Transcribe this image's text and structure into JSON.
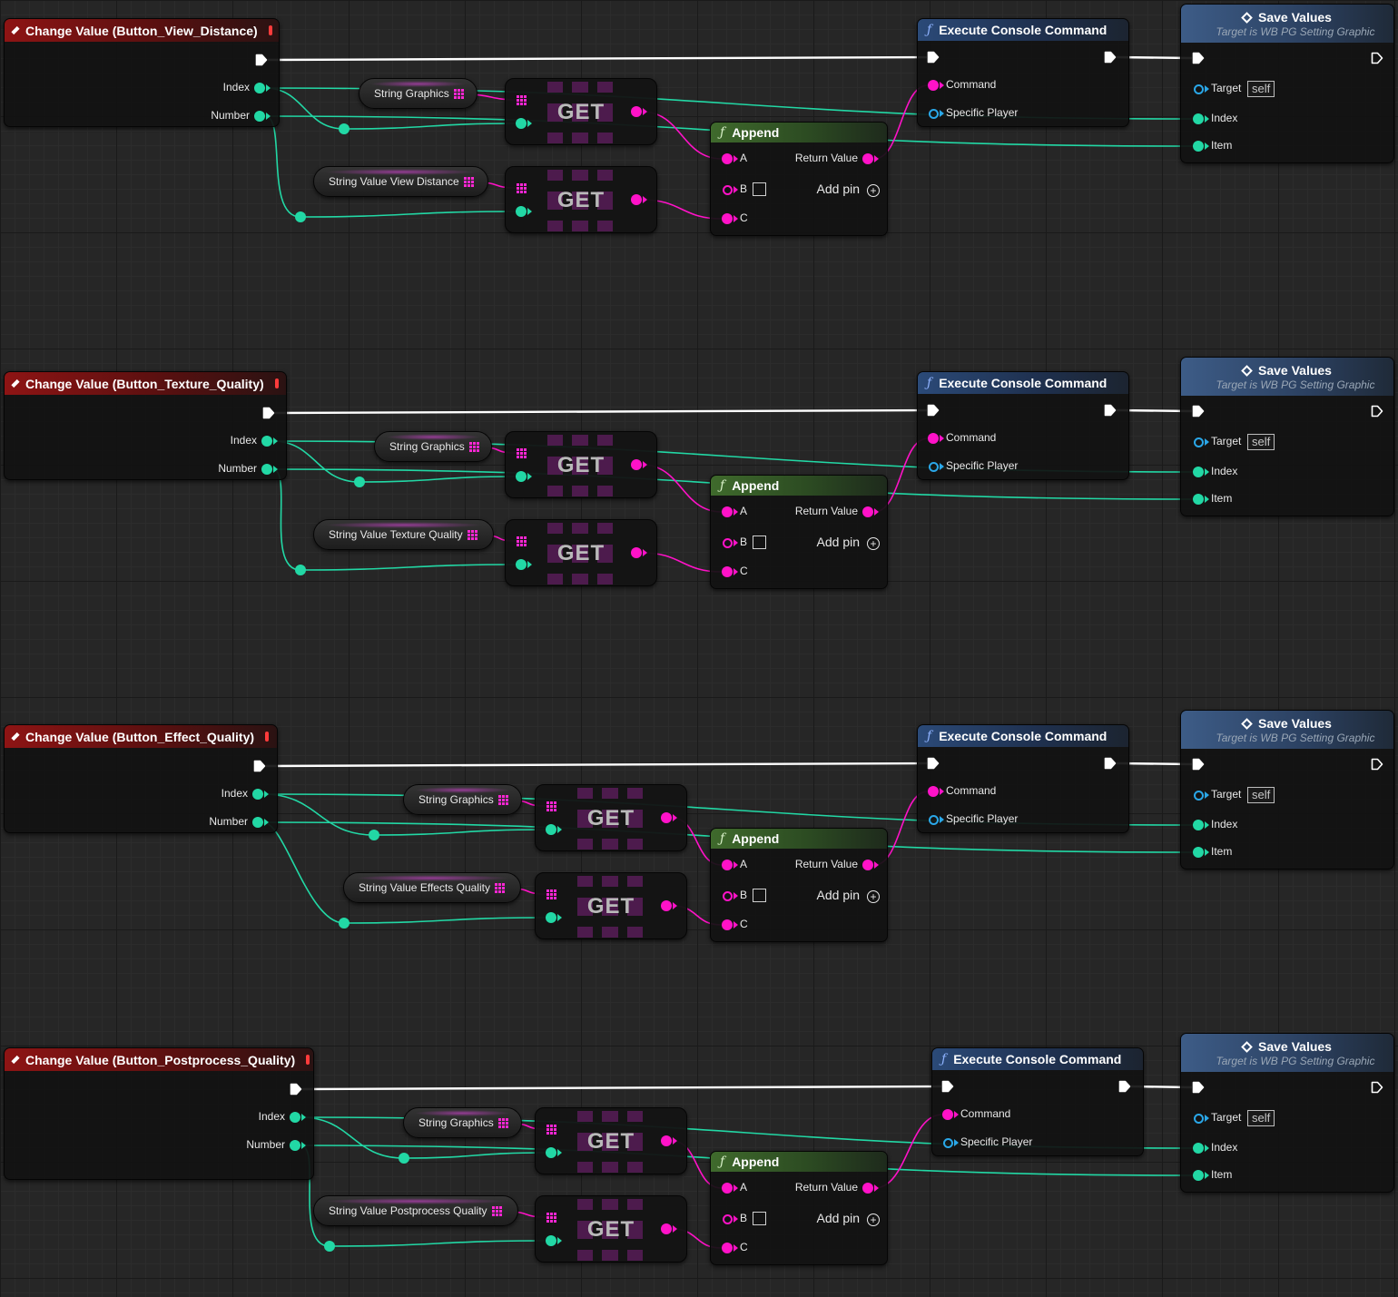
{
  "graphs": [
    {
      "event_title": "Change Value (Button_View_Distance)",
      "event_pins": {
        "index": "Index",
        "number": "Number"
      },
      "var_graphics": "String Graphics",
      "var_value": "String Value View Distance",
      "get_label": "GET",
      "append": {
        "title": "Append",
        "a": "A",
        "b": "B",
        "c": "C",
        "return": "Return Value",
        "add_pin": "Add pin"
      },
      "exec_cmd": {
        "title": "Execute Console Command",
        "command": "Command",
        "player": "Specific Player"
      },
      "save": {
        "title": "Save Values",
        "subtitle": "Target is WB PG Setting Graphic",
        "target": "Target",
        "self": "self",
        "index": "Index",
        "item": "Item"
      }
    },
    {
      "event_title": "Change Value (Button_Texture_Quality)",
      "event_pins": {
        "index": "Index",
        "number": "Number"
      },
      "var_graphics": "String Graphics",
      "var_value": "String Value Texture Quality",
      "get_label": "GET",
      "append": {
        "title": "Append",
        "a": "A",
        "b": "B",
        "c": "C",
        "return": "Return Value",
        "add_pin": "Add pin"
      },
      "exec_cmd": {
        "title": "Execute Console Command",
        "command": "Command",
        "player": "Specific Player"
      },
      "save": {
        "title": "Save Values",
        "subtitle": "Target is WB PG Setting Graphic",
        "target": "Target",
        "self": "self",
        "index": "Index",
        "item": "Item"
      }
    },
    {
      "event_title": "Change Value (Button_Effect_Quality)",
      "event_pins": {
        "index": "Index",
        "number": "Number"
      },
      "var_graphics": "String Graphics",
      "var_value": "String Value Effects Quality",
      "get_label": "GET",
      "append": {
        "title": "Append",
        "a": "A",
        "b": "B",
        "c": "C",
        "return": "Return Value",
        "add_pin": "Add pin"
      },
      "exec_cmd": {
        "title": "Execute Console Command",
        "command": "Command",
        "player": "Specific Player"
      },
      "save": {
        "title": "Save Values",
        "subtitle": "Target is WB PG Setting Graphic",
        "target": "Target",
        "self": "self",
        "index": "Index",
        "item": "Item"
      }
    },
    {
      "event_title": "Change Value (Button_Postprocess_Quality)",
      "event_pins": {
        "index": "Index",
        "number": "Number"
      },
      "var_graphics": "String Graphics",
      "var_value": "String Value Postprocess Quality",
      "get_label": "GET",
      "append": {
        "title": "Append",
        "a": "A",
        "b": "B",
        "c": "C",
        "return": "Return Value",
        "add_pin": "Add pin"
      },
      "exec_cmd": {
        "title": "Execute Console Command",
        "command": "Command",
        "player": "Specific Player"
      },
      "save": {
        "title": "Save Values",
        "subtitle": "Target is WB PG Setting Graphic",
        "target": "Target",
        "self": "self",
        "index": "Index",
        "item": "Item"
      }
    }
  ],
  "colors": {
    "background": "#262626",
    "integer_pin": "#22d8a5",
    "string_pin": "#ff12c8",
    "object_pin": "#2aa7e8",
    "exec_wire": "#ffffff",
    "event_header": "#8e1414",
    "function_header": "#2b4a78",
    "append_header": "#3f6a2c"
  },
  "icons": {
    "event": "event-diamond-icon",
    "function": "function-f-icon",
    "array": "array-grid-icon",
    "exec": "exec-pin-icon",
    "add": "add-pin-plus-icon",
    "stop": "event-stop-icon"
  }
}
